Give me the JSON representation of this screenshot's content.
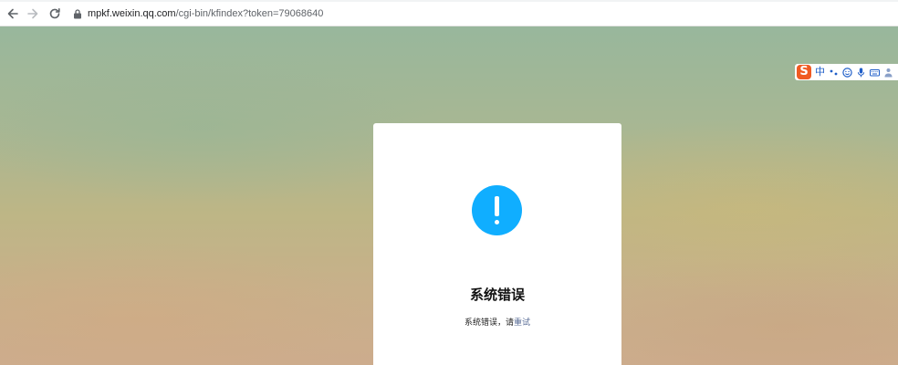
{
  "browser": {
    "url_host": "mpkf.weixin.qq.com",
    "url_path": "/cgi-bin/kfindex?token=79068640",
    "back_icon": "back-arrow-icon",
    "forward_icon": "forward-arrow-icon",
    "reload_icon": "reload-icon",
    "lock_icon": "lock-icon"
  },
  "ime_toolbar": {
    "logo": "S",
    "mode_label": "中",
    "icons": [
      "punctuation-icon",
      "emoji-icon",
      "microphone-icon",
      "keyboard-icon",
      "skin-icon"
    ],
    "logo_color": "#f05a22",
    "accent_color": "#1f5ec8"
  },
  "error_card": {
    "icon": "exclamation-icon",
    "icon_color": "#10aeff",
    "title": "系统错误",
    "message_prefix": "系统错误，请",
    "retry_link": "重试",
    "link_color": "#576b95"
  }
}
